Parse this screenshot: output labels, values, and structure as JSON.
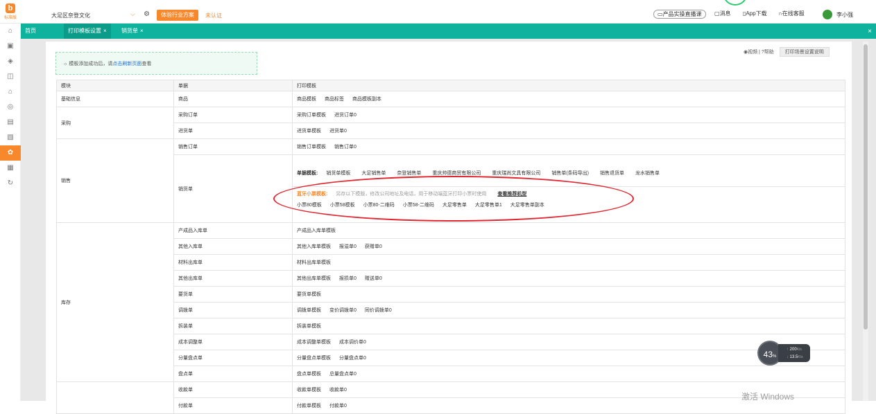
{
  "header": {
    "logo_text": "标准版",
    "company": "大足区奈登文化",
    "industry_button": "体验行业方案",
    "unverified": "未认证",
    "demo_button": "产品实操直播课",
    "messages": "消息",
    "app_download": "App下载",
    "online_service": "在线客服",
    "user_name": "李小强"
  },
  "tabs": [
    {
      "label": "首页",
      "close": ""
    },
    {
      "label": "打印模板设置",
      "close": "×"
    },
    {
      "label": "销货单",
      "close": "×"
    }
  ],
  "tabs_close_all": "×",
  "notice": {
    "text": "模板添加成功后，请",
    "link": "点击刷新页面",
    "suffix": "查看"
  },
  "tools": {
    "video": "视频",
    "help": "帮助",
    "guide": "打印场景设置说明"
  },
  "table": {
    "headers": [
      "模块",
      "单据",
      "打印模板"
    ],
    "rows": [
      {
        "module": "基础信息",
        "doc": "商品",
        "templates": [
          "商品模板",
          "商品标签",
          "商品模板副本"
        ]
      },
      {
        "module": "采购",
        "doc": "采购订单",
        "templates": [
          "采购订单模板",
          "进货订单0"
        ]
      },
      {
        "module": "",
        "doc": "进货单",
        "templates": [
          "进货单模板",
          "进货单0"
        ]
      },
      {
        "module": "销售",
        "doc": "销售订单",
        "templates": [
          "销售订单模板",
          "销售订单0"
        ]
      },
      {
        "module": "",
        "doc": "销货单",
        "templates": []
      },
      {
        "module": "库存",
        "doc": "产成品入库单",
        "templates": [
          "产成品入库单模板"
        ]
      },
      {
        "module": "",
        "doc": "其他入库单",
        "templates": [
          "其他入库单模板",
          "报溢单0",
          "获赠单0"
        ]
      },
      {
        "module": "",
        "doc": "材料出库单",
        "templates": [
          "材料出库单模板"
        ]
      },
      {
        "module": "",
        "doc": "其他出库单",
        "templates": [
          "其他出库单模板",
          "报损单0",
          "赠送单0"
        ]
      },
      {
        "module": "",
        "doc": "要货单",
        "templates": [
          "要货单模板"
        ]
      },
      {
        "module": "",
        "doc": "调拨单",
        "templates": [
          "调拨单模板",
          "变价调拨单0",
          "同价调拨单0"
        ]
      },
      {
        "module": "",
        "doc": "拆装单",
        "templates": [
          "拆装单模板"
        ]
      },
      {
        "module": "",
        "doc": "成本调整单",
        "templates": [
          "成本调整单模板",
          "成本调价单0"
        ]
      },
      {
        "module": "",
        "doc": "分量盘点单",
        "templates": [
          "分量盘点单模板",
          "分量盘点单0"
        ]
      },
      {
        "module": "",
        "doc": "盘点单",
        "templates": [
          "盘点单模板",
          "总量盘点单0"
        ]
      },
      {
        "module": "",
        "doc": "收款单",
        "templates": [
          "收款单模板",
          "收款单0"
        ]
      },
      {
        "module": "",
        "doc": "付款单",
        "templates": [
          "付款单模板",
          "付款单0"
        ]
      }
    ],
    "sales_detail": {
      "doc_title": "单据模板:",
      "doc_templates": [
        "销货单模板",
        "大足销售单",
        "奈登销售单",
        "重庆帅德商贸有限公司",
        "重庆瑞尚文具有限公司",
        "销售单(条码导出)",
        "销售退货单",
        "龙水销售单"
      ],
      "bt_title": "蓝牙小票模板:",
      "bt_note": "另存以下模版，修改公司地址及电话，用于移动端蓝牙打印小票时使用",
      "bt_link": "查看推荐机型",
      "bt_templates": [
        "小票80模板",
        "小票58模板",
        "小票80-二维码",
        "小票58-二维码",
        "大足零售单",
        "大足零售单1",
        "大足零售单副本"
      ]
    }
  },
  "net_widget": {
    "percent": "43",
    "percent_unit": "%",
    "up": "200",
    "up_unit": "K/s",
    "down": "13.5",
    "down_unit": "K/s"
  },
  "watermark": "激活 Windows"
}
